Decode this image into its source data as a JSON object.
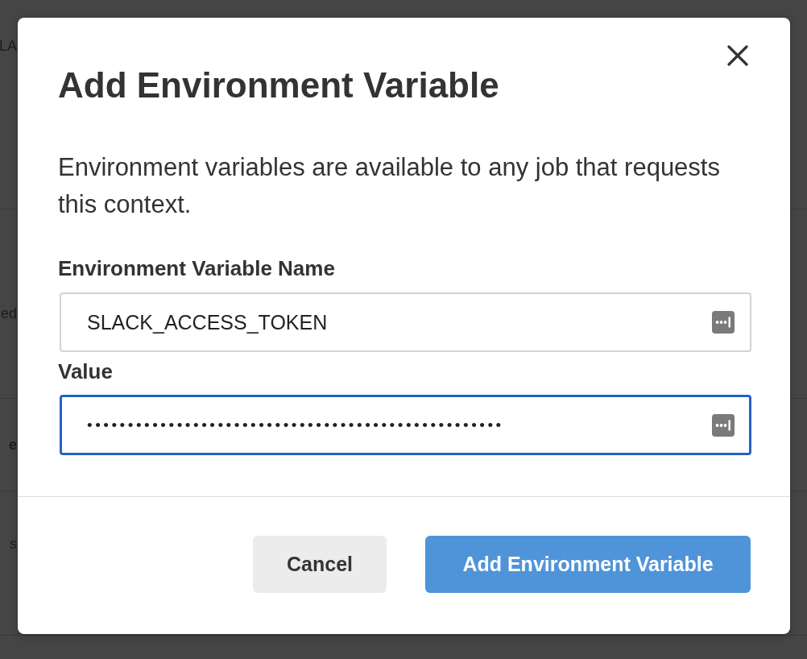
{
  "background_fragments": [
    {
      "text": "LA",
      "bold": false
    },
    {
      "text": "ed",
      "bold": false
    },
    {
      "text": "e",
      "bold": true
    },
    {
      "text": "s",
      "bold": false
    }
  ],
  "dialog": {
    "title": "Add Environment Variable",
    "description": "Environment variables are available to any job that requests this context.",
    "fields": [
      {
        "label": "Environment Variable Name",
        "value": "SLACK_ACCESS_TOKEN",
        "focused": false
      },
      {
        "label": "Value",
        "value": "•••••••••••••••••••••••••••••••••••••••••••••••••••",
        "focused": true
      }
    ],
    "buttons": [
      {
        "label": "Cancel",
        "kind": "secondary"
      },
      {
        "label": "Add Environment Variable",
        "kind": "primary"
      }
    ]
  }
}
